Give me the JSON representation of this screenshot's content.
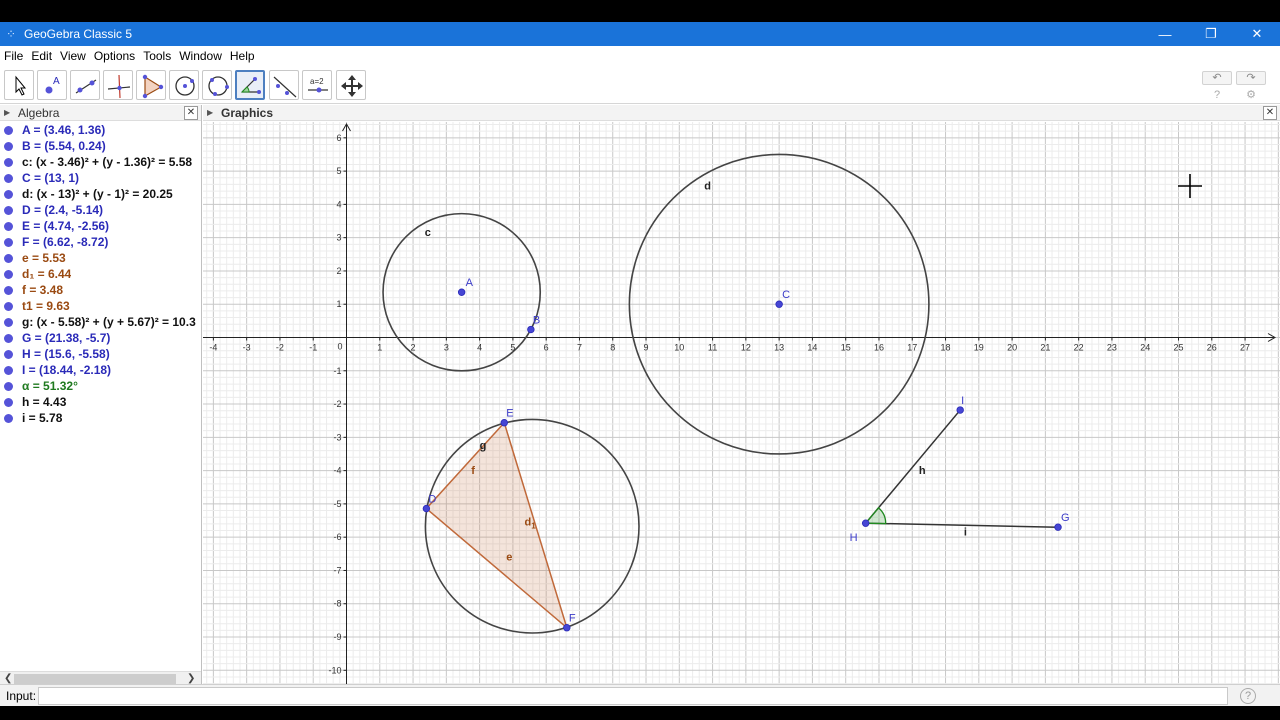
{
  "window": {
    "title": "GeoGebra Classic 5",
    "minimize": "—",
    "restore": "❐",
    "close": "✕"
  },
  "menu": [
    "File",
    "Edit",
    "View",
    "Options",
    "Tools",
    "Window",
    "Help"
  ],
  "toolbar": {
    "tools": [
      "move-tool",
      "point-tool",
      "line-tool",
      "perpendicular-line-tool",
      "polygon-tool",
      "circle-center-tool",
      "circle-three-points-tool",
      "angle-tool",
      "reflect-tool",
      "slider-tool",
      "move-graphics-view-tool"
    ],
    "selected_index": 7,
    "slider_label": "a=2",
    "undo": "↶",
    "redo": "↷",
    "help_icon": "?",
    "settings_icon": "⚙"
  },
  "algebra": {
    "title": "Algebra",
    "close": "✕",
    "items": [
      {
        "text": "A = (3.46, 1.36)",
        "color": "#2a2ab8"
      },
      {
        "text": "B = (5.54, 0.24)",
        "color": "#2a2ab8"
      },
      {
        "text": "c: (x - 3.46)² + (y - 1.36)² = 5.58",
        "color": "#111111"
      },
      {
        "text": "C = (13, 1)",
        "color": "#2a2ab8"
      },
      {
        "text": "d: (x - 13)² + (y - 1)² = 20.25",
        "color": "#111111"
      },
      {
        "text": "D = (2.4, -5.14)",
        "color": "#2a2ab8"
      },
      {
        "text": "E = (4.74, -2.56)",
        "color": "#2a2ab8"
      },
      {
        "text": "F = (6.62, -8.72)",
        "color": "#2a2ab8"
      },
      {
        "text": "e = 5.53",
        "color": "#9a4a12"
      },
      {
        "text": "d₁ = 6.44",
        "color": "#9a4a12"
      },
      {
        "text": "f = 3.48",
        "color": "#9a4a12"
      },
      {
        "text": "t1 = 9.63",
        "color": "#9a4a12"
      },
      {
        "text": "g: (x - 5.58)² + (y + 5.67)² = 10.3",
        "color": "#111111"
      },
      {
        "text": "G = (21.38, -5.7)",
        "color": "#2a2ab8"
      },
      {
        "text": "H = (15.6, -5.58)",
        "color": "#2a2ab8"
      },
      {
        "text": "I = (18.44, -2.18)",
        "color": "#2a2ab8"
      },
      {
        "text": "α = 51.32°",
        "color": "#1f7a1f"
      },
      {
        "text": "h = 4.43",
        "color": "#111111"
      },
      {
        "text": "i = 5.78",
        "color": "#111111"
      }
    ],
    "scroll_left": "❮",
    "scroll_right": "❯"
  },
  "graphics": {
    "title": "Graphics",
    "close": "✕",
    "xlim": [
      -4,
      27
    ],
    "ylim": [
      -10,
      6
    ],
    "points": [
      {
        "name": "A",
        "x": 3.46,
        "y": 1.36
      },
      {
        "name": "B",
        "x": 5.54,
        "y": 0.24
      },
      {
        "name": "C",
        "x": 13,
        "y": 1
      },
      {
        "name": "D",
        "x": 2.4,
        "y": -5.14
      },
      {
        "name": "E",
        "x": 4.74,
        "y": -2.56
      },
      {
        "name": "F",
        "x": 6.62,
        "y": -8.72
      },
      {
        "name": "G",
        "x": 21.38,
        "y": -5.7
      },
      {
        "name": "H",
        "x": 15.6,
        "y": -5.58
      },
      {
        "name": "I",
        "x": 18.44,
        "y": -2.18
      }
    ],
    "circles": [
      {
        "name": "c",
        "cx": 3.46,
        "cy": 1.36,
        "r": 2.362
      },
      {
        "name": "d",
        "cx": 13,
        "cy": 1,
        "r": 4.5
      },
      {
        "name": "g",
        "cx": 5.58,
        "cy": -5.67,
        "r": 3.209
      }
    ],
    "triangle_sides": [
      "e",
      "d1",
      "f"
    ],
    "segment_labels": [
      "h",
      "i"
    ],
    "point_color": "#4646d4",
    "polygon_color": "#c0693a",
    "angle_color": "#1f8a1f"
  },
  "inputbar": {
    "label": "Input:",
    "value": "",
    "help": "?"
  }
}
